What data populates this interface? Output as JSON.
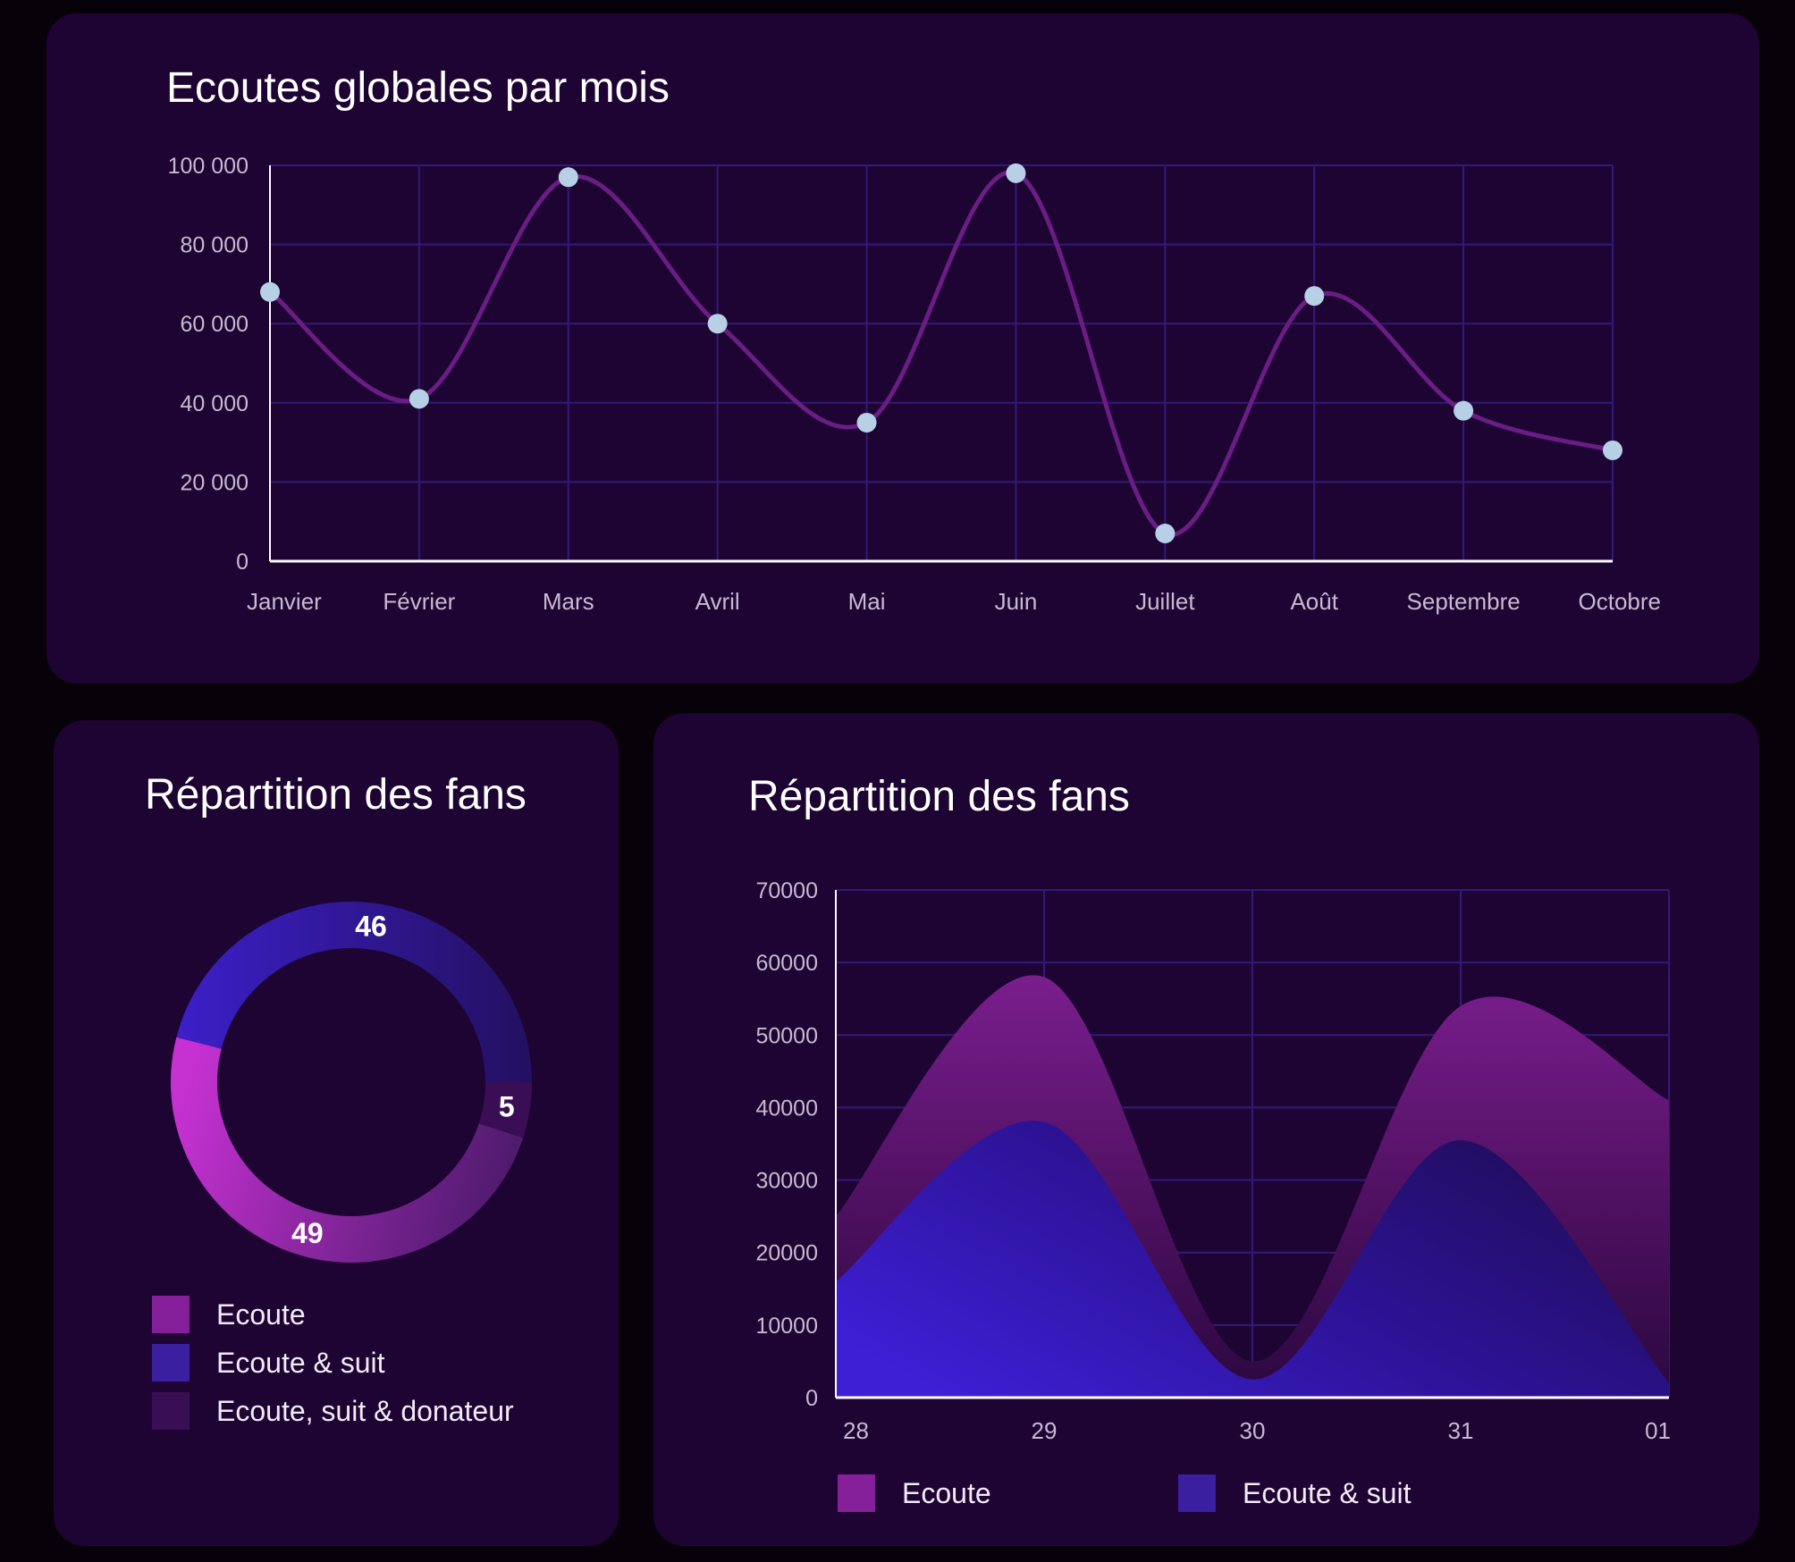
{
  "colors": {
    "background": "#070209",
    "card": "#1e0432",
    "grid": "#33197a",
    "axis": "#ffffff",
    "tick_text": "#c8b9d2",
    "line": "#6a1d84",
    "point": "#b7d0e6",
    "ecoute": "#85209a",
    "ecoute_suit": "#3a1fa0",
    "ecoute_suit_donateur": "#3a0e55"
  },
  "line_card": {
    "title": "Ecoutes globales par mois"
  },
  "donut_card": {
    "title": "Répartition des fans",
    "legend": [
      {
        "label": "Ecoute",
        "color": "#85209a"
      },
      {
        "label": "Ecoute & suit",
        "color": "#3a1fa0"
      },
      {
        "label": "Ecoute, suit & donateur",
        "color": "#3a0e55"
      }
    ]
  },
  "area_card": {
    "title": "Répartition des fans",
    "legend": [
      {
        "label": "Ecoute",
        "color": "#85209a"
      },
      {
        "label": "Ecoute & suit",
        "color": "#3a1fa0"
      }
    ]
  },
  "chart_data": [
    {
      "type": "line",
      "title": "Ecoutes globales par mois",
      "categories": [
        "Janvier",
        "Février",
        "Mars",
        "Avril",
        "Mai",
        "Juin",
        "Juillet",
        "Août",
        "Septembre",
        "Octobre"
      ],
      "values": [
        68000,
        41000,
        97000,
        60000,
        35000,
        98000,
        7000,
        67000,
        38000,
        28000
      ],
      "ylim": [
        0,
        100000
      ],
      "yticks": [
        0,
        20000,
        40000,
        60000,
        80000,
        100000
      ],
      "ytick_labels": [
        "0",
        "20 000",
        "40 000",
        "60 000",
        "80 000",
        "100 000"
      ],
      "curve": "smooth",
      "grid": true
    },
    {
      "type": "pie",
      "title": "Répartition des fans",
      "donut": true,
      "categories": [
        "Ecoute & suit",
        "Ecoute",
        "Ecoute, suit & donateur"
      ],
      "values": [
        46,
        49,
        5
      ],
      "legend_position": "bottom-left"
    },
    {
      "type": "area",
      "title": "Répartition des fans",
      "x": [
        "28",
        "29",
        "30",
        "31",
        "01"
      ],
      "series": [
        {
          "name": "Ecoute",
          "values": [
            25000,
            58000,
            5000,
            54000,
            41000
          ]
        },
        {
          "name": "Ecoute & suit",
          "values": [
            16000,
            38000,
            2500,
            35500,
            2000
          ]
        }
      ],
      "ylim": [
        0,
        70000
      ],
      "yticks": [
        0,
        10000,
        20000,
        30000,
        40000,
        50000,
        60000,
        70000
      ],
      "ytick_labels": [
        "0",
        "10000",
        "20000",
        "30000",
        "40000",
        "50000",
        "60000",
        "70000"
      ],
      "grid": true,
      "legend_position": "bottom"
    }
  ]
}
